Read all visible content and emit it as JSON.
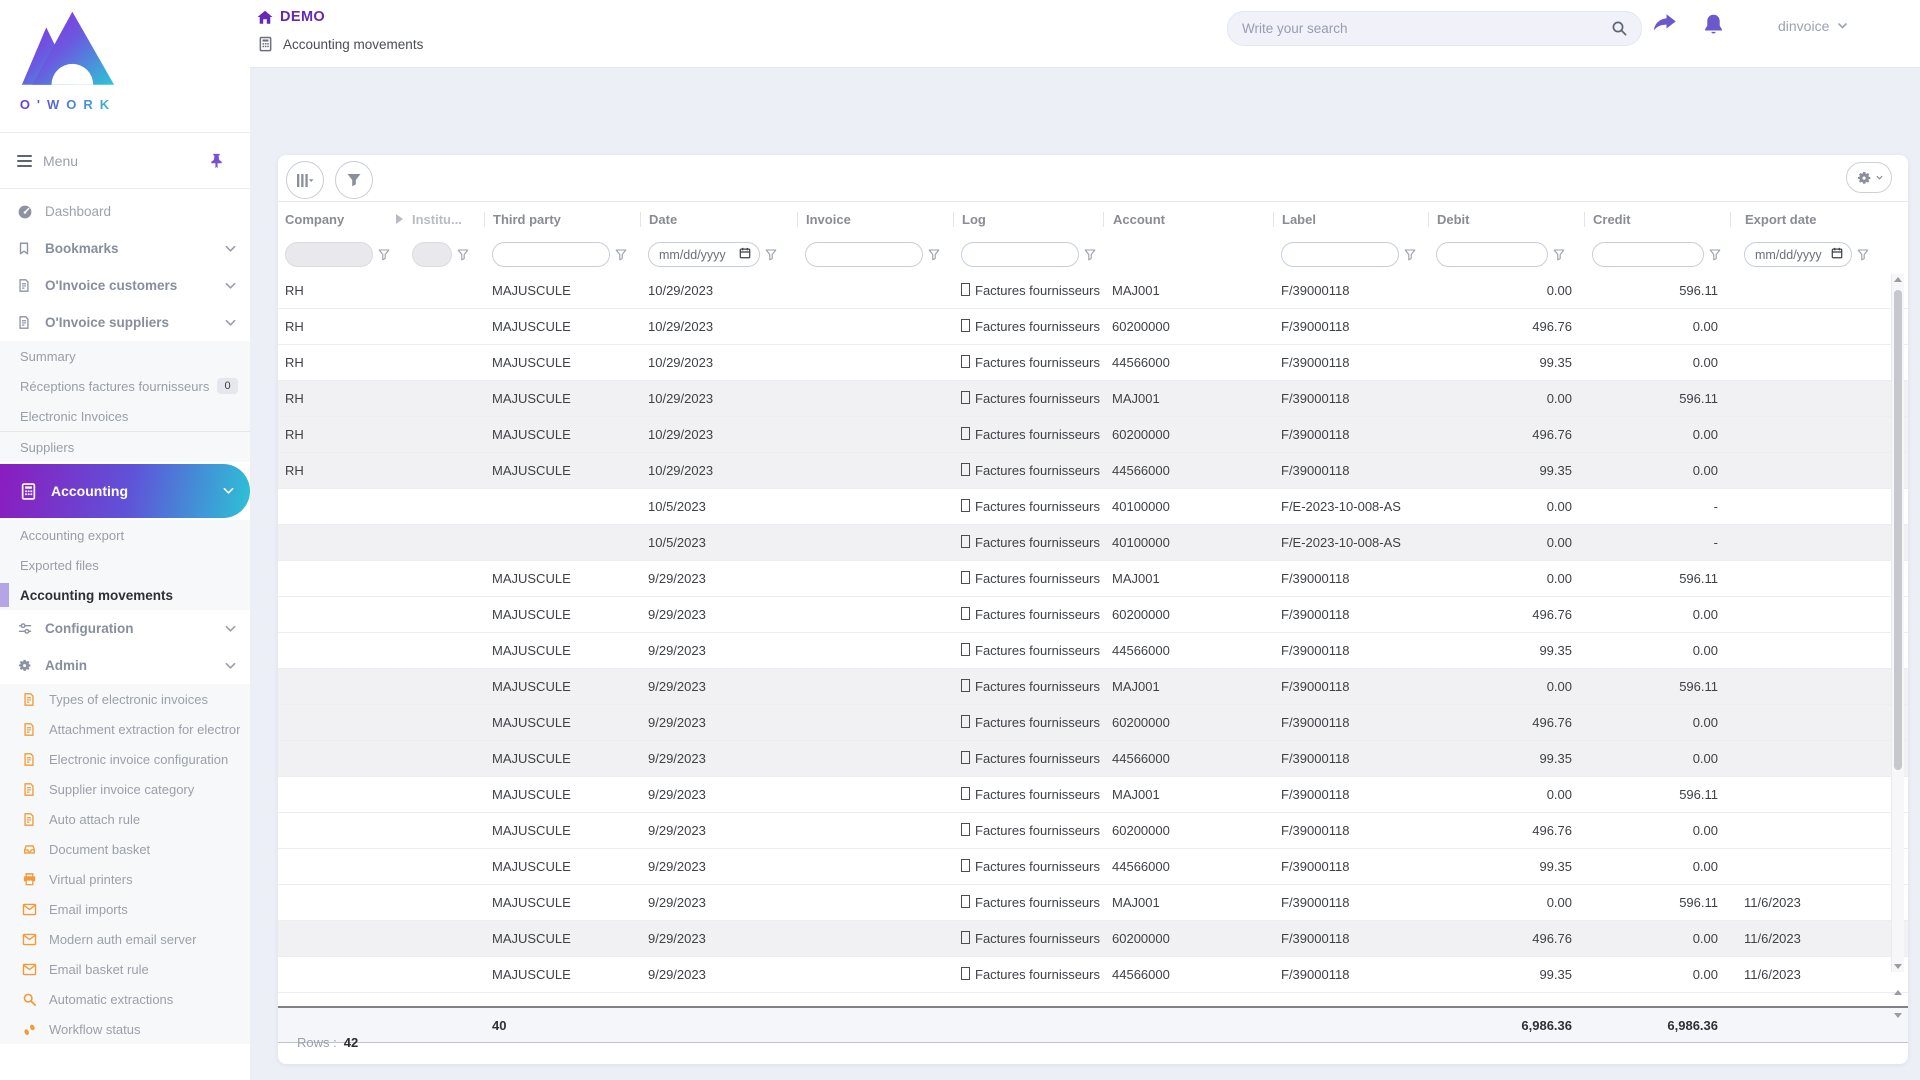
{
  "brand": {
    "logo_text": "O'WORK"
  },
  "colors": {
    "brand_purple": "#6527b8",
    "accent": "#6a58cc",
    "gradient_from": "#8b1cbe",
    "gradient_to": "#2cc2d6",
    "orange": "#f29b38",
    "active_bar": "#b5a4e6"
  },
  "topbar": {
    "env": "DEMO",
    "breadcrumb": "Accounting movements",
    "search_placeholder": "Write your search",
    "username": "dinvoice"
  },
  "sidebar": {
    "menu_label": "Menu",
    "items": [
      {
        "kind": "item",
        "plain": true,
        "icon": "dashboard",
        "label": "Dashboard"
      },
      {
        "kind": "item",
        "icon": "bookmark",
        "label": "Bookmarks",
        "chevron": true
      },
      {
        "kind": "item",
        "icon": "document",
        "label": "O'Invoice customers",
        "chevron": true
      },
      {
        "kind": "item",
        "icon": "document",
        "label": "O'Invoice suppliers",
        "chevron": true
      },
      {
        "kind": "sub",
        "label": "Summary"
      },
      {
        "kind": "sub",
        "label": "Réceptions factures fournisseurs",
        "badge": "0"
      },
      {
        "kind": "sub",
        "label": "Electronic Invoices",
        "divider": true
      },
      {
        "kind": "sub",
        "label": "Suppliers"
      },
      {
        "kind": "accounting",
        "icon": "calculator",
        "label": "Accounting",
        "chevron": true
      },
      {
        "kind": "sub",
        "label": "Accounting export"
      },
      {
        "kind": "sub",
        "label": "Exported files"
      },
      {
        "kind": "subactive",
        "label": "Accounting movements"
      },
      {
        "kind": "item",
        "icon": "sliders",
        "label": "Configuration",
        "chevron": true
      },
      {
        "kind": "item",
        "icon": "gear",
        "label": "Admin",
        "chevron": true
      },
      {
        "kind": "adminsub",
        "icon": "document",
        "label": "Types of electronic invoices"
      },
      {
        "kind": "adminsub",
        "icon": "document",
        "label": "Attachment extraction for electron"
      },
      {
        "kind": "adminsub",
        "icon": "document",
        "label": "Electronic invoice configuration"
      },
      {
        "kind": "adminsub",
        "icon": "document",
        "label": "Supplier invoice category"
      },
      {
        "kind": "adminsub",
        "icon": "document",
        "label": "Auto attach rule"
      },
      {
        "kind": "adminsub",
        "icon": "inbox",
        "label": "Document basket"
      },
      {
        "kind": "adminsub",
        "icon": "printer",
        "label": "Virtual printers"
      },
      {
        "kind": "adminsub",
        "icon": "mail",
        "label": "Email imports"
      },
      {
        "kind": "adminsub",
        "icon": "mail",
        "label": "Modern auth email server"
      },
      {
        "kind": "adminsub",
        "icon": "mail",
        "label": "Email basket rule"
      },
      {
        "kind": "adminsub",
        "icon": "searcho",
        "label": "Automatic extractions"
      },
      {
        "kind": "adminsub",
        "icon": "steps",
        "label": "Workflow status"
      }
    ]
  },
  "table": {
    "headers": {
      "company": "Company",
      "institution": "Institu...",
      "third_party": "Third party",
      "date": "Date",
      "invoice": "Invoice",
      "log": "Log",
      "account": "Account",
      "label": "Label",
      "debit": "Debit",
      "credit": "Credit",
      "export_date": "Export date"
    },
    "date_placeholder": "mm/dd/yyyy",
    "log_glyph": "[]",
    "rows": [
      {
        "company": "RH",
        "third_party": "MAJUSCULE",
        "date": "10/29/2023",
        "invoice": "",
        "log": "Factures fournisseurs",
        "account": "MAJ001",
        "label": "F/39000118",
        "debit": "0.00",
        "credit": "596.11",
        "export_date": "",
        "shade": "w"
      },
      {
        "company": "RH",
        "third_party": "MAJUSCULE",
        "date": "10/29/2023",
        "invoice": "",
        "log": "Factures fournisseurs",
        "account": "60200000",
        "label": "F/39000118",
        "debit": "496.76",
        "credit": "0.00",
        "export_date": "",
        "shade": "w"
      },
      {
        "company": "RH",
        "third_party": "MAJUSCULE",
        "date": "10/29/2023",
        "invoice": "",
        "log": "Factures fournisseurs",
        "account": "44566000",
        "label": "F/39000118",
        "debit": "99.35",
        "credit": "0.00",
        "export_date": "",
        "shade": "w"
      },
      {
        "company": "RH",
        "third_party": "MAJUSCULE",
        "date": "10/29/2023",
        "invoice": "",
        "log": "Factures fournisseurs",
        "account": "MAJ001",
        "label": "F/39000118",
        "debit": "0.00",
        "credit": "596.11",
        "export_date": "",
        "shade": "g"
      },
      {
        "company": "RH",
        "third_party": "MAJUSCULE",
        "date": "10/29/2023",
        "invoice": "",
        "log": "Factures fournisseurs",
        "account": "60200000",
        "label": "F/39000118",
        "debit": "496.76",
        "credit": "0.00",
        "export_date": "",
        "shade": "g"
      },
      {
        "company": "RH",
        "third_party": "MAJUSCULE",
        "date": "10/29/2023",
        "invoice": "",
        "log": "Factures fournisseurs",
        "account": "44566000",
        "label": "F/39000118",
        "debit": "99.35",
        "credit": "0.00",
        "export_date": "",
        "shade": "g"
      },
      {
        "company": "",
        "third_party": "",
        "date": "10/5/2023",
        "invoice": "",
        "log": "Factures fournisseurs",
        "account": "40100000",
        "label": "F/E-2023-10-008-AS",
        "debit": "0.00",
        "credit": "-",
        "export_date": "",
        "shade": "w"
      },
      {
        "company": "",
        "third_party": "",
        "date": "10/5/2023",
        "invoice": "",
        "log": "Factures fournisseurs",
        "account": "40100000",
        "label": "F/E-2023-10-008-AS",
        "debit": "0.00",
        "credit": "-",
        "export_date": "",
        "shade": "g"
      },
      {
        "company": "",
        "third_party": "MAJUSCULE",
        "date": "9/29/2023",
        "invoice": "",
        "log": "Factures fournisseurs",
        "account": "MAJ001",
        "label": "F/39000118",
        "debit": "0.00",
        "credit": "596.11",
        "export_date": "",
        "shade": "w"
      },
      {
        "company": "",
        "third_party": "MAJUSCULE",
        "date": "9/29/2023",
        "invoice": "",
        "log": "Factures fournisseurs",
        "account": "60200000",
        "label": "F/39000118",
        "debit": "496.76",
        "credit": "0.00",
        "export_date": "",
        "shade": "w"
      },
      {
        "company": "",
        "third_party": "MAJUSCULE",
        "date": "9/29/2023",
        "invoice": "",
        "log": "Factures fournisseurs",
        "account": "44566000",
        "label": "F/39000118",
        "debit": "99.35",
        "credit": "0.00",
        "export_date": "",
        "shade": "w"
      },
      {
        "company": "",
        "third_party": "MAJUSCULE",
        "date": "9/29/2023",
        "invoice": "",
        "log": "Factures fournisseurs",
        "account": "MAJ001",
        "label": "F/39000118",
        "debit": "0.00",
        "credit": "596.11",
        "export_date": "",
        "shade": "g"
      },
      {
        "company": "",
        "third_party": "MAJUSCULE",
        "date": "9/29/2023",
        "invoice": "",
        "log": "Factures fournisseurs",
        "account": "60200000",
        "label": "F/39000118",
        "debit": "496.76",
        "credit": "0.00",
        "export_date": "",
        "shade": "g"
      },
      {
        "company": "",
        "third_party": "MAJUSCULE",
        "date": "9/29/2023",
        "invoice": "",
        "log": "Factures fournisseurs",
        "account": "44566000",
        "label": "F/39000118",
        "debit": "99.35",
        "credit": "0.00",
        "export_date": "",
        "shade": "g"
      },
      {
        "company": "",
        "third_party": "MAJUSCULE",
        "date": "9/29/2023",
        "invoice": "",
        "log": "Factures fournisseurs",
        "account": "MAJ001",
        "label": "F/39000118",
        "debit": "0.00",
        "credit": "596.11",
        "export_date": "",
        "shade": "w"
      },
      {
        "company": "",
        "third_party": "MAJUSCULE",
        "date": "9/29/2023",
        "invoice": "",
        "log": "Factures fournisseurs",
        "account": "60200000",
        "label": "F/39000118",
        "debit": "496.76",
        "credit": "0.00",
        "export_date": "",
        "shade": "w"
      },
      {
        "company": "",
        "third_party": "MAJUSCULE",
        "date": "9/29/2023",
        "invoice": "",
        "log": "Factures fournisseurs",
        "account": "44566000",
        "label": "F/39000118",
        "debit": "99.35",
        "credit": "0.00",
        "export_date": "",
        "shade": "w"
      },
      {
        "company": "",
        "third_party": "MAJUSCULE",
        "date": "9/29/2023",
        "invoice": "",
        "log": "Factures fournisseurs",
        "account": "MAJ001",
        "label": "F/39000118",
        "debit": "0.00",
        "credit": "596.11",
        "export_date": "11/6/2023",
        "shade": "w"
      },
      {
        "company": "",
        "third_party": "MAJUSCULE",
        "date": "9/29/2023",
        "invoice": "",
        "log": "Factures fournisseurs",
        "account": "60200000",
        "label": "F/39000118",
        "debit": "496.76",
        "credit": "0.00",
        "export_date": "11/6/2023",
        "shade": "g"
      },
      {
        "company": "",
        "third_party": "MAJUSCULE",
        "date": "9/29/2023",
        "invoice": "",
        "log": "Factures fournisseurs",
        "account": "44566000",
        "label": "F/39000118",
        "debit": "99.35",
        "credit": "0.00",
        "export_date": "11/6/2023",
        "shade": "w"
      }
    ],
    "totals": {
      "count": "40",
      "debit": "6,986.36",
      "credit": "6,986.36"
    },
    "footer": {
      "rows_label": "Rows :",
      "rows_value": "42"
    }
  }
}
